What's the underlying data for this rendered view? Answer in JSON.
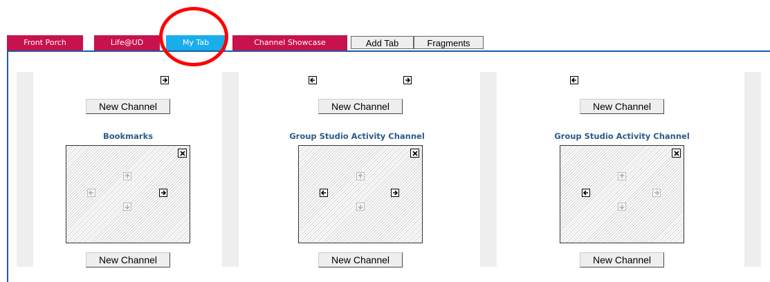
{
  "tabs": [
    {
      "label": "Front Porch",
      "state": "inactive"
    },
    {
      "label": "Life@UD",
      "state": "inactive"
    },
    {
      "label": "My Tab",
      "state": "active"
    },
    {
      "label": "Channel Showcase",
      "state": "inactive"
    }
  ],
  "tab_buttons": {
    "add_tab": "Add Tab",
    "fragments": "Fragments"
  },
  "columns": [
    {
      "new_channel_top": "New Channel",
      "channel_title": "Bookmarks",
      "new_channel_bottom": "New Channel"
    },
    {
      "new_channel_top": "New Channel",
      "channel_title": "Group Studio Activity Channel",
      "new_channel_bottom": "New Channel"
    },
    {
      "new_channel_top": "New Channel",
      "channel_title": "Group Studio Activity Channel",
      "new_channel_bottom": "New Channel"
    }
  ],
  "colors": {
    "tab_red": "#c8124d",
    "tab_active": "#19aeea",
    "border_blue": "#1a5aa8",
    "title_blue": "#2b5a8a",
    "highlight_circle": "#ff0000"
  }
}
